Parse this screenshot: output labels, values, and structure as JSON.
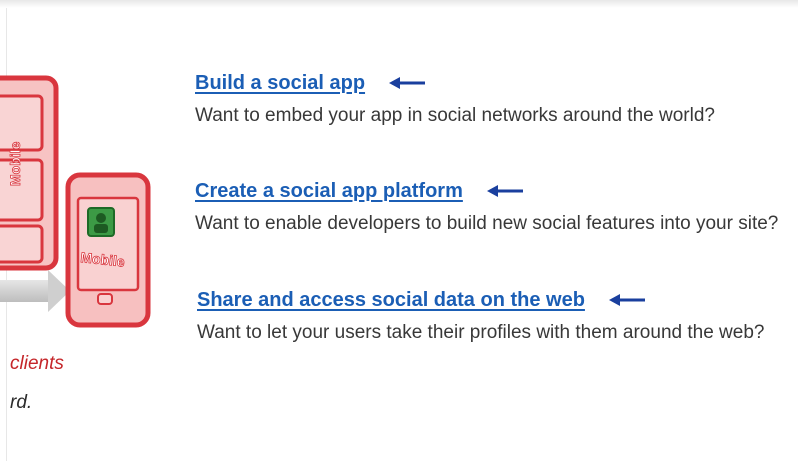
{
  "illustration": {
    "device_label_top": "Mobile",
    "device_label_bottom": "Mobile",
    "caption_red": "clients",
    "caption_black": "rd."
  },
  "items": [
    {
      "link": "Build a social app",
      "description": "Want to embed your app in social networks around the world?",
      "arrow_icon": "left-arrow-icon"
    },
    {
      "link": "Create a social app platform",
      "description": "Want to enable developers to build new social features into your site?",
      "arrow_icon": "left-arrow-icon"
    },
    {
      "link": "Share and access social data on the web",
      "description": "Want to let your users take their profiles with them around the web?",
      "arrow_icon": "left-arrow-icon"
    }
  ],
  "colors": {
    "link": "#1b5eb5",
    "arrow": "#1a3f9e",
    "description": "#383838",
    "device_red": "#d9363e",
    "device_fill": "#f6b8b8",
    "caption_red": "#c5262a"
  }
}
